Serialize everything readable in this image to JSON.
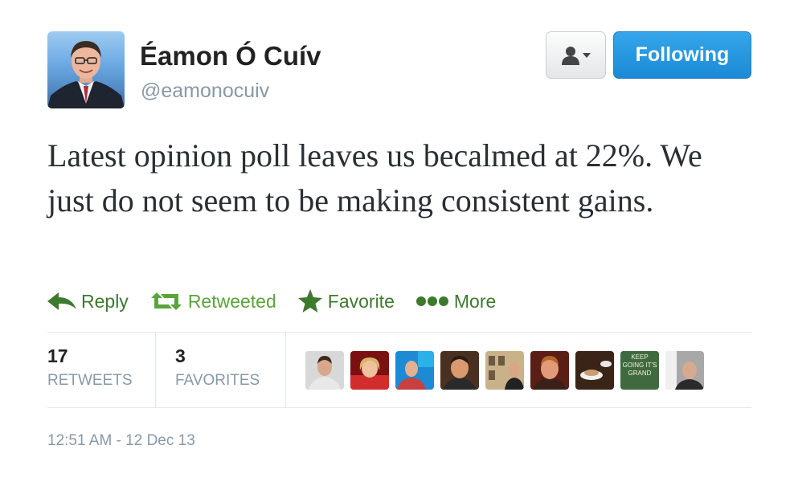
{
  "author": {
    "name": "Éamon Ó Cuív",
    "handle": "@eamonocuiv"
  },
  "header": {
    "follow_label": "Following",
    "accent_color": "#1b95e0"
  },
  "tweet": {
    "text": "Latest opinion poll leaves us becalmed at 22%. We just do not seem to be making consistent gains."
  },
  "actions": {
    "reply": "Reply",
    "retweeted": "Retweeted",
    "favorite": "Favorite",
    "more": "More",
    "action_color": "#3d7a2e"
  },
  "stats": {
    "retweets_count": "17",
    "retweets_label": "RETWEETS",
    "favorites_count": "3",
    "favorites_label": "FAVORITES"
  },
  "favoriters": {
    "poster_text": "KEEP GOING IT'S GRAND"
  },
  "timestamp": "12:51 AM - 12 Dec 13"
}
